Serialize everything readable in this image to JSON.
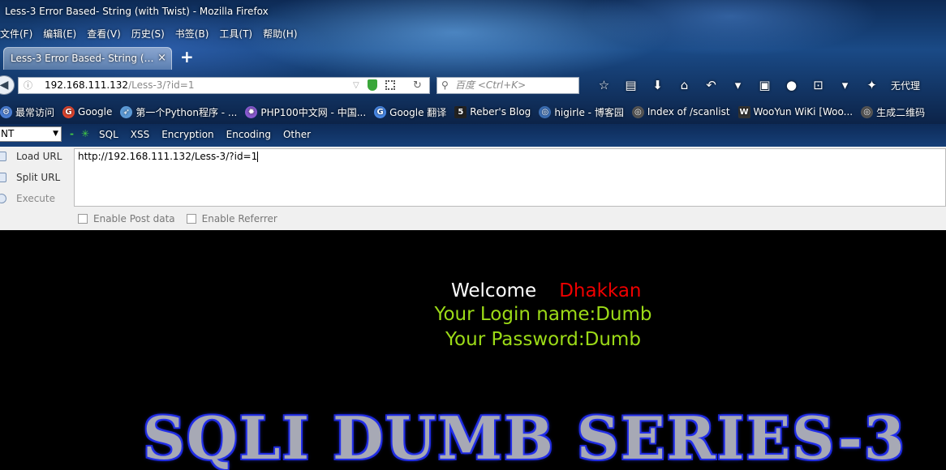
{
  "window": {
    "title": "Less-3 Error Based- String (with Twist) - Mozilla Firefox"
  },
  "menu": [
    "文件(F)",
    "编辑(E)",
    "查看(V)",
    "历史(S)",
    "书签(B)",
    "工具(T)",
    "帮助(H)"
  ],
  "tab": {
    "label": "Less-3 Error Based- String (…",
    "close": "×",
    "new": "+"
  },
  "address": {
    "host": "192.168.111.132",
    "path": "/Less-3/?id=1"
  },
  "search": {
    "placeholder": "百度 <Ctrl+K>"
  },
  "toolbar": {
    "proxy_label": "无代理"
  },
  "bookmarks": [
    {
      "label": "最常访问",
      "icon": "gear-icon",
      "color": "#4a7fd6"
    },
    {
      "label": "Google",
      "icon": "google-icon",
      "color": "#e0462f"
    },
    {
      "label": "第一个Python程序 - ...",
      "icon": "rocket-icon",
      "color": "#5c9ad6"
    },
    {
      "label": "PHP100中文网 - 中国...",
      "icon": "php-icon",
      "color": "#8a5ad0"
    },
    {
      "label": "Google 翻译",
      "icon": "translate-icon",
      "color": "#4a8ae8"
    },
    {
      "label": "Reber's Blog",
      "icon": "five-icon",
      "color": "#222222"
    },
    {
      "label": "higirle - 博客园",
      "icon": "globe-icon",
      "color": "#3c6fb5"
    },
    {
      "label": "Index of /scanlist",
      "icon": "globe-icon",
      "color": "#555555"
    },
    {
      "label": "WooYun WiKi [Woo...",
      "icon": "wooyun-icon",
      "color": "#333333"
    },
    {
      "label": "生成二维码",
      "icon": "globe-icon",
      "color": "#555555"
    }
  ],
  "hackbar": {
    "select_value": "NT",
    "menu": [
      "SQL",
      "XSS",
      "Encryption",
      "Encoding",
      "Other"
    ],
    "load_url": "Load URL",
    "split_url": "Split URL",
    "execute": "Execute",
    "url_value": "http://192.168.111.132/Less-3/?id=1",
    "post_label": "Enable Post data",
    "referrer_label": "Enable Referrer"
  },
  "content": {
    "welcome": "Welcome",
    "name": "Dhakkan",
    "login": "Your Login name:Dumb",
    "password": "Your Password:Dumb",
    "banner": "SQLI DUMB SERIES-3"
  },
  "colors": {
    "login_text": "#9cdb17",
    "name_text": "#e00000",
    "banner_outline": "#1c26c9"
  }
}
